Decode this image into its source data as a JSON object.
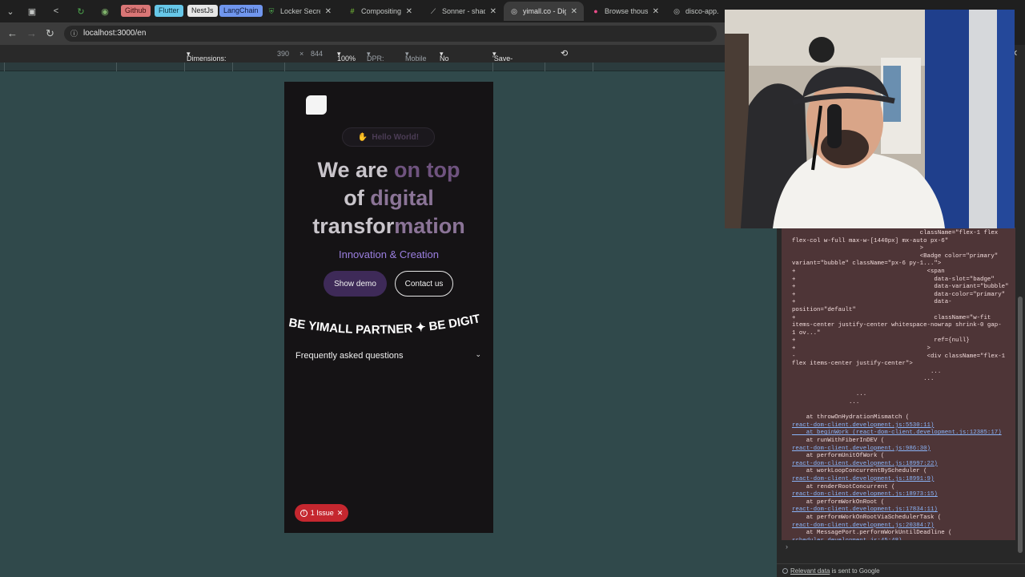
{
  "tabs": [
    {
      "label": "Compositing",
      "icon": "leaf-icon"
    },
    {
      "label": "Sonner - shadc",
      "icon": "slash-icon"
    },
    {
      "label": "yimall.co - Dig",
      "icon": "globe-icon",
      "active": true
    },
    {
      "label": "Browse thousa",
      "icon": "dribbble-icon"
    },
    {
      "label": "disco-app.dra",
      "icon": "globe-icon"
    }
  ],
  "secret_tab": {
    "label": "Locker Secrets"
  },
  "bookmarks": [
    {
      "label": "Github",
      "color": "#d97676"
    },
    {
      "label": "Flutter",
      "color": "#67c7e8"
    },
    {
      "label": "NestJs",
      "color": "#e6e6e6"
    },
    {
      "label": "LangChain",
      "color": "#7096ee"
    }
  ],
  "address": {
    "url": "localhost:3000/en"
  },
  "device_toolbar": {
    "dimensions": "Dimensions: iPhone 12 Pro",
    "width": "390",
    "times": "×",
    "height": "844",
    "zoom": "100%",
    "dpr": "DPR: 3.0",
    "mobile": "Mobile",
    "throttling": "No throttling",
    "save_data": "'Save-Data': default"
  },
  "page": {
    "hello": "Hello World!",
    "headline": {
      "l1a": "We are ",
      "l1b": "on top",
      "l2a": "of ",
      "l2b": "digital",
      "l3a": "transfor",
      "l3b": "mation"
    },
    "subtitle": "Innovation & Creation",
    "btn_demo": "Show demo",
    "btn_contact": "Contact us",
    "marquee": "BE YIMALL PARTNER ✦ BE DIGIT",
    "faq": "Frequently asked questions",
    "issue": "1 Issue"
  },
  "console_lines": [
    {
      "t": "                                    className=\"flex-1 flex"
    },
    {
      "t": "flex-col w-full max-w-[1440px] mx-auto px-6\""
    },
    {
      "t": "                                    >"
    },
    {
      "t": "                                    <Badge color=\"primary\""
    },
    {
      "t": "variant=\"bubble\" className=\"px-6 py-1...\">"
    },
    {
      "t": "+                                     <span"
    },
    {
      "t": "+                                       data-slot=\"badge\""
    },
    {
      "t": "+                                       data-variant=\"bubble\""
    },
    {
      "t": "+                                       data-color=\"primary\""
    },
    {
      "t": "+                                       data-"
    },
    {
      "t": "position=\"default\""
    },
    {
      "t": "+                                       className=\"w-fit"
    },
    {
      "t": "items-center justify-center whitespace-nowrap shrink-0 gap-"
    },
    {
      "t": "1 ov...\""
    },
    {
      "t": "+                                       ref={null}"
    },
    {
      "t": "+                                     >"
    },
    {
      "t": "-                                     <div className=\"flex-1"
    },
    {
      "t": "flex items-center justify-center\">"
    },
    {
      "t": "                                       ..."
    },
    {
      "t": "                                     ..."
    },
    {
      "t": ""
    },
    {
      "t": "                  ..."
    },
    {
      "t": "                ..."
    },
    {
      "t": ""
    },
    {
      "t": "    at throwOnHydrationMismatch ("
    },
    {
      "t": "react-dom-client.development.js:5530:11)",
      "link": true
    },
    {
      "t": "    at beginWork (react-dom-client.development.js:12385:17)",
      "link": true
    },
    {
      "t": "    at runWithFiberInDEV ("
    },
    {
      "t": "react-dom-client.development.js:986:30)",
      "link": true
    },
    {
      "t": "    at performUnitOfWork ("
    },
    {
      "t": "react-dom-client.development.js:18997:22)",
      "link": true
    },
    {
      "t": "    at workLoopConcurrentByScheduler ("
    },
    {
      "t": "react-dom-client.development.js:18991:9)",
      "link": true
    },
    {
      "t": "    at renderRootConcurrent ("
    },
    {
      "t": "react-dom-client.development.js:18973:15)",
      "link": true
    },
    {
      "t": "    at performWorkOnRoot ("
    },
    {
      "t": "react-dom-client.development.js:17834:11)",
      "link": true
    },
    {
      "t": "    at performWorkOnRootViaSchedulerTask ("
    },
    {
      "t": "react-dom-client.development.js:20384:7)",
      "link": true
    },
    {
      "t": "    at MessagePort.performWorkUntilDeadline ("
    },
    {
      "t": "scheduler.development.js:45:48)",
      "link": true
    }
  ],
  "footer": {
    "link": "Relevant data",
    "text": " is sent to Google"
  },
  "colors": {
    "phone_bg": "#151315",
    "viewport_bg": "#30494b",
    "accent": "#9b7fe0",
    "issue": "#c5272f"
  }
}
